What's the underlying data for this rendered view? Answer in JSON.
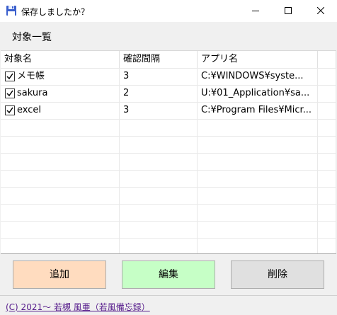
{
  "window": {
    "title": "保存しましたか？"
  },
  "section_label": "対象一覧",
  "table": {
    "columns": [
      "対象名",
      "確認間隔",
      "アプリ名"
    ],
    "rows": [
      {
        "checked": true,
        "name": "メモ帳",
        "interval": "3",
        "app": "C:¥WINDOWS¥syste..."
      },
      {
        "checked": true,
        "name": "sakura",
        "interval": "2",
        "app": "U:¥01_Application¥sa..."
      },
      {
        "checked": true,
        "name": "excel",
        "interval": "3",
        "app": "C:¥Program Files¥Micr..."
      }
    ]
  },
  "buttons": {
    "add": "追加",
    "edit": "編集",
    "delete": "削除"
  },
  "footer_link": "(C) 2021～ 若槻 風亜（若風備忘録）"
}
